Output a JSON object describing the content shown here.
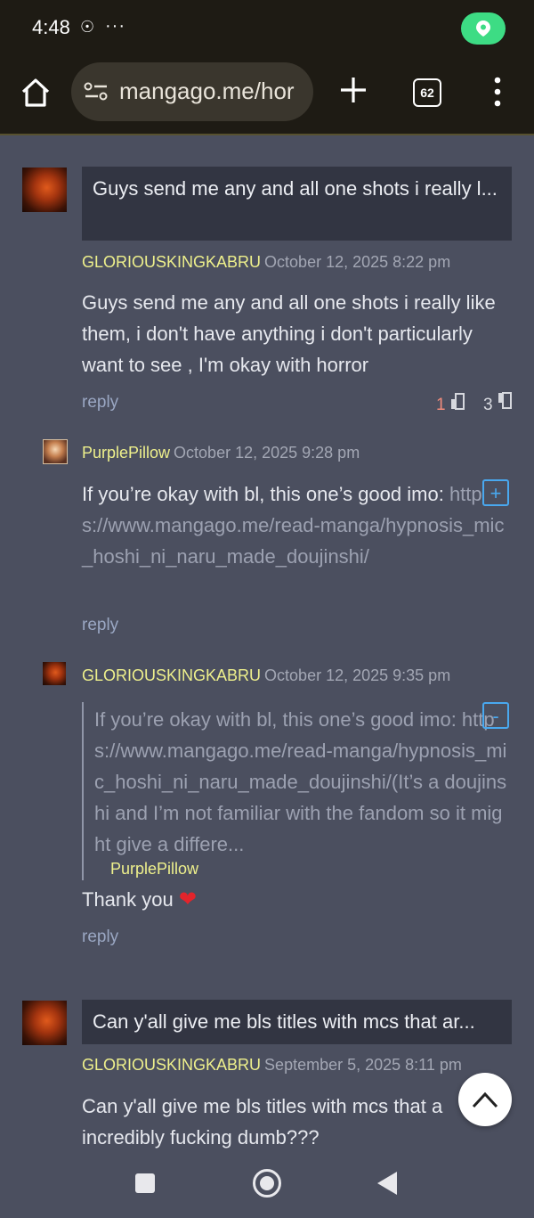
{
  "status_bar": {
    "time": "4:48",
    "dots": "···"
  },
  "browser": {
    "url": "mangago.me/hor",
    "tab_count": "62"
  },
  "comments": [
    {
      "title": "Guys send me any and all one shots i really l...",
      "author": "GLORIOUSKINGKABRU",
      "date": "October 12, 2025 8:22 pm",
      "body": "Guys send me any and all one shots i really like them, i don't have anything i don't particularly want to see , I'm okay with horror",
      "reply": "reply",
      "likes": "1",
      "dislikes": "3"
    },
    {
      "author": "PurplePillow",
      "date": "October 12, 2025 9:28 pm",
      "body": "If you’re okay with bl, this one’s good imo:",
      "link": "https://www.mangago.me/read-manga/hypnosis_mic_hoshi_ni_naru_made_doujinshi/",
      "reply": "reply",
      "toggle": "+"
    },
    {
      "author": "GLORIOUSKINGKABRU",
      "date": "October 12, 2025 9:35 pm",
      "quote": "If you’re okay with bl, this one’s good imo: https://www.mangago.me/read-manga/hypnosis_mic_hoshi_ni_naru_made_doujinshi/(It’s a doujinshi and I’m not familiar with the fandom so it might give a differe...",
      "quote_author": "PurplePillow",
      "body": "Thank you",
      "reply": "reply",
      "toggle": "-"
    },
    {
      "title": "Can y'all give me bls titles with mcs that ar...",
      "author": "GLORIOUSKINGKABRU",
      "date": "September 5, 2025 8:11 pm",
      "body": "Can y'all give me bls titles with mcs that a incredibly fucking dumb???"
    }
  ]
}
